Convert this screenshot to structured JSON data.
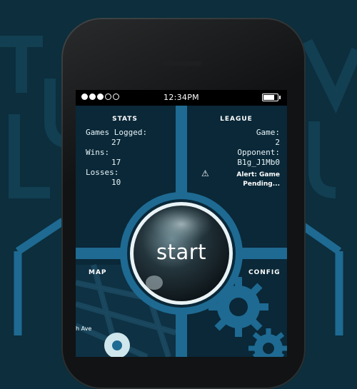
{
  "background": {
    "color": "#0c2e3d",
    "watermark_color": "#123f52",
    "hex_color": "#1e6a92"
  },
  "status_bar": {
    "signal_dots": [
      true,
      true,
      true,
      false,
      false
    ],
    "time": "12:34PM",
    "battery_level": 0.85
  },
  "stats": {
    "title": "STATS",
    "games_logged_label": "Games Logged:",
    "games_logged_value": "27",
    "wins_label": "Wins:",
    "wins_value": "17",
    "losses_label": "Losses:",
    "losses_value": "10"
  },
  "league": {
    "title": "LEAGUE",
    "game_label": "Game:",
    "game_value": "2",
    "opponent_label": "Opponent:",
    "opponent_value": "B1g_J1Mb0",
    "alert_line1": "Alert: Game",
    "alert_line2": "Pending...",
    "warning_icon": "warning-icon"
  },
  "start_button": {
    "label": "start"
  },
  "map": {
    "title": "MAP",
    "street_label": "h Ave"
  },
  "config": {
    "title": "CONFIG"
  },
  "colors": {
    "accent": "#1e6a92",
    "panel": "#0a2838",
    "orb_ring": "#2d7fb0"
  }
}
